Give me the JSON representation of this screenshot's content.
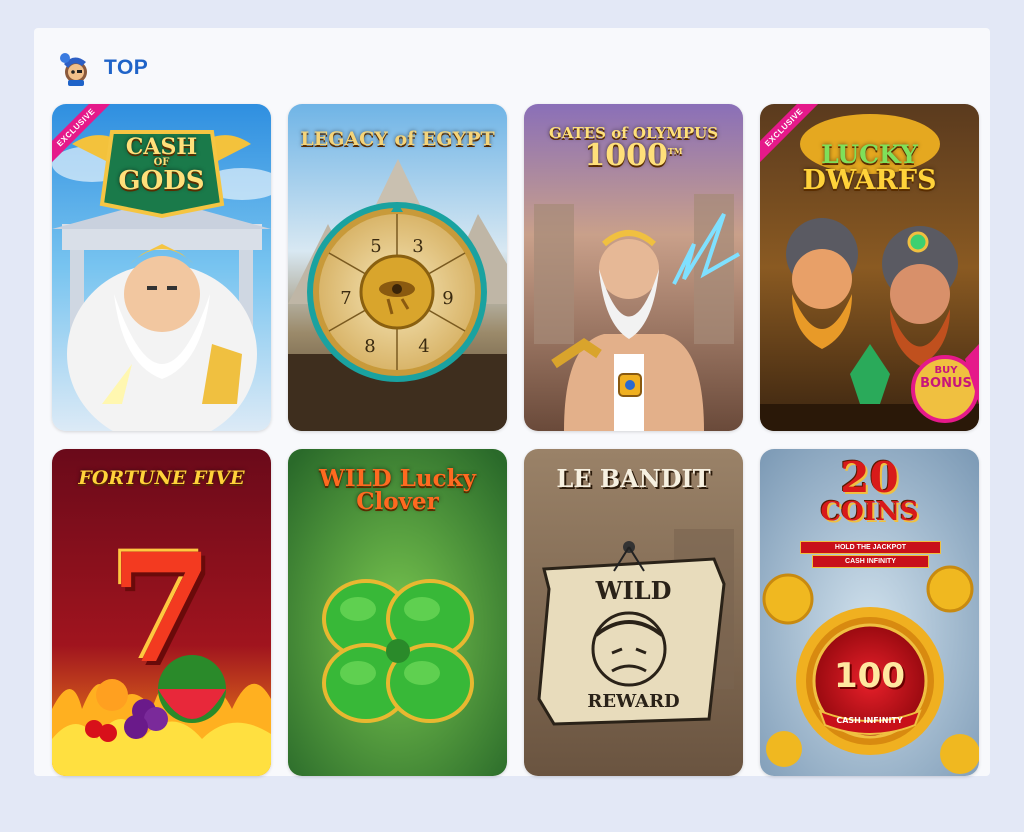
{
  "section": {
    "title": "TOP",
    "icon": "pirate-mascot-icon"
  },
  "games": [
    {
      "id": "cash-of-gods",
      "title_top": "CASH",
      "title_mid": "OF",
      "title_bottom": "GODS",
      "badge": "EXCLUSIVE"
    },
    {
      "id": "legacy-of-egypt",
      "title": "LEGACY of EGYPT",
      "wheel_numbers": [
        "5",
        "3",
        "7",
        "9",
        "8",
        "4"
      ]
    },
    {
      "id": "gates-of-olympus-1000",
      "title_top": "GATES of OLYMPUS",
      "title_bottom": "1000",
      "tm": "TM"
    },
    {
      "id": "lucky-dwarfs",
      "title_top": "LUCKY",
      "title_bottom": "DWARFS",
      "badge": "EXCLUSIVE",
      "bonus_top": "BUY",
      "bonus_bottom": "BONUS"
    },
    {
      "id": "fortune-five",
      "title": "FORTUNE FIVE",
      "symbol": "7"
    },
    {
      "id": "wild-lucky-clover",
      "title_top": "WILD Lucky",
      "title_bottom": "Clover"
    },
    {
      "id": "le-bandit",
      "title": "LE BANDIT",
      "poster_top": "WILD",
      "poster_bottom": "REWARD"
    },
    {
      "id": "20-coins",
      "title_top": "20",
      "title_mid": "COINS",
      "tagline1": "HOLD THE JACKPOT",
      "tagline2": "CASH INFINITY",
      "coin_value": "100",
      "coin_caption": "CASH INFINITY"
    }
  ]
}
